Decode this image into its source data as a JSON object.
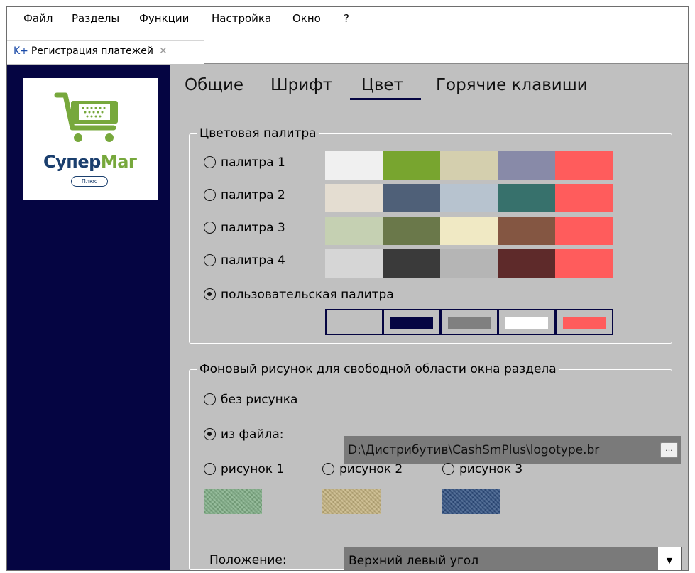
{
  "menu": [
    "Файл",
    "Разделы",
    "Функции",
    "Настройка",
    "Окно",
    "?"
  ],
  "doc_tab": {
    "prefix": "K+",
    "label": "Регистрация платежей",
    "close": "✕"
  },
  "logo": {
    "brand_part1": "Супер",
    "brand_part2": "Маг",
    "badge": "Плюс"
  },
  "tabs": [
    "Общие",
    "Шрифт",
    "Цвет",
    "Горячие клавиши"
  ],
  "active_tab": "Цвет",
  "palette_group": {
    "legend": "Цветовая палитра",
    "palettes": [
      {
        "label": "палитра 1",
        "selected": false,
        "colors": [
          "#f0f0f0",
          "#78a52f",
          "#d4cfae",
          "#888aa8",
          "#ff5c5c"
        ]
      },
      {
        "label": "палитра 2",
        "selected": false,
        "colors": [
          "#e4ddd1",
          "#4f6078",
          "#b7c3cf",
          "#37716c",
          "#ff5c5c"
        ]
      },
      {
        "label": "палитра 3",
        "selected": false,
        "colors": [
          "#c5d0b2",
          "#6a784a",
          "#f0e9c4",
          "#845642",
          "#ff5c5c"
        ]
      },
      {
        "label": "палитра 4",
        "selected": false,
        "colors": [
          "#d6d6d6",
          "#3a3a3a",
          "#b5b5b5",
          "#5e2a2a",
          "#ff5c5c"
        ]
      }
    ],
    "custom": {
      "label": "пользовательская палитра",
      "selected": true,
      "colors": [
        "#c0c0c0",
        "#050542",
        "#808080",
        "#ffffff",
        "#ff5c5c"
      ]
    }
  },
  "background_group": {
    "legend": "Фоновый рисунок для свободной области окна раздела",
    "none_label": "без рисунка",
    "file_label": "из файла:",
    "file_path": "D:\\Дистрибутив\\CashSmPlus\\logotype.br",
    "browse_label": "...",
    "pictures": [
      {
        "label": "рисунок 1",
        "color": "#7fae86"
      },
      {
        "label": "рисунок 2",
        "color": "#c4b27e"
      },
      {
        "label": "рисунок 3",
        "color": "#2e4e80"
      }
    ],
    "selected": "file",
    "position_label": "Положение:",
    "position_value": "Верхний левый угол",
    "dropdown_arrow": "▼"
  }
}
